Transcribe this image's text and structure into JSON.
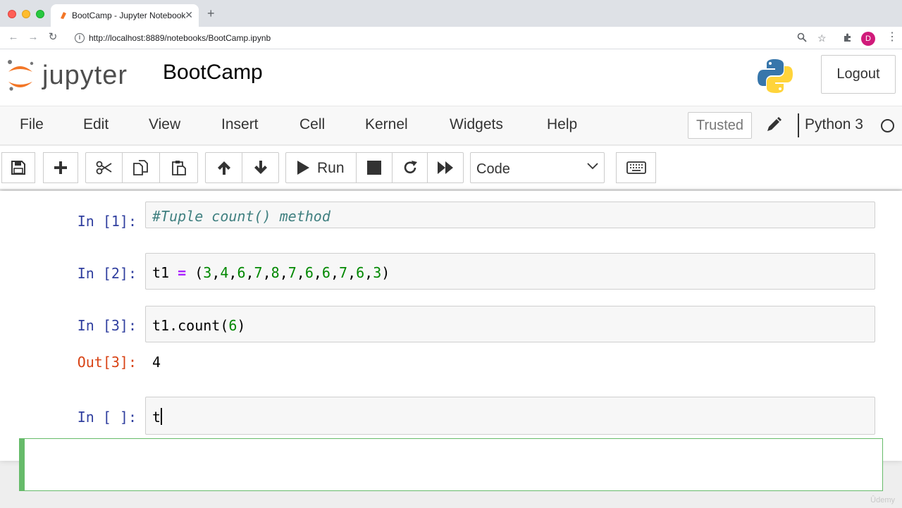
{
  "browser": {
    "tab_title": "BootCamp - Jupyter Notebook",
    "url": "http://localhost:8889/notebooks/BootCamp.ipynb",
    "profile_initial": "D"
  },
  "header": {
    "logo_text": "jupyter",
    "notebook_name": "BootCamp",
    "logout_label": "Logout"
  },
  "menu": {
    "items": [
      "File",
      "Edit",
      "View",
      "Insert",
      "Cell",
      "Kernel",
      "Widgets",
      "Help"
    ],
    "trusted_label": "Trusted",
    "kernel_name": "Python 3"
  },
  "toolbar": {
    "run_label": "Run",
    "cell_type": "Code"
  },
  "cells": [
    {
      "prompt": "In [1]:",
      "code": "#Tuple count() method"
    },
    {
      "prompt": "In [2]:",
      "code": "t1 = (3,4,6,7,8,7,6,6,7,6,3)"
    },
    {
      "prompt": "In [3]:",
      "code": "t1.count(6)",
      "out_prompt": "Out[3]:",
      "output": "4"
    },
    {
      "prompt": "In [ ]:",
      "code": "t"
    }
  ],
  "watermark": "Ûdemy",
  "colors": {
    "prompt_in": "#303f9f",
    "prompt_out": "#d84315",
    "selected_border": "#66bb6a"
  }
}
